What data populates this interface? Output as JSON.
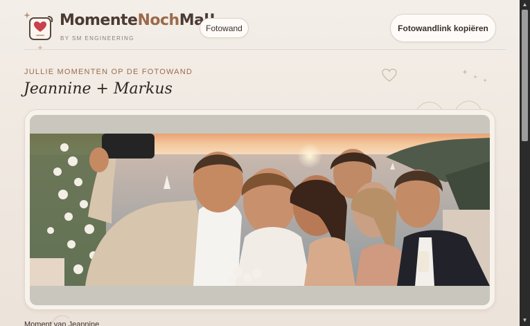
{
  "header": {
    "brand_part1": "Momente",
    "brand_part2": "Noch",
    "brand_part3": "Mal!",
    "byline": "BY SM ENGINEERING",
    "fotowand_label": "Fotowand",
    "copy_link_label": "Fotowandlink kopiëren"
  },
  "gallery": {
    "eyebrow": "JULLIE MOMENTEN OP DE FOTOWAND",
    "couple": "Jeannine + Markus",
    "moment_label": "Moment van Jeannine"
  },
  "colors": {
    "accent": "#9b6a4a",
    "heart": "#c8414b",
    "background": "#f2ece6"
  },
  "icons": {
    "logo": "photo-heart-icon",
    "decoration": "heart-outline-icon"
  }
}
